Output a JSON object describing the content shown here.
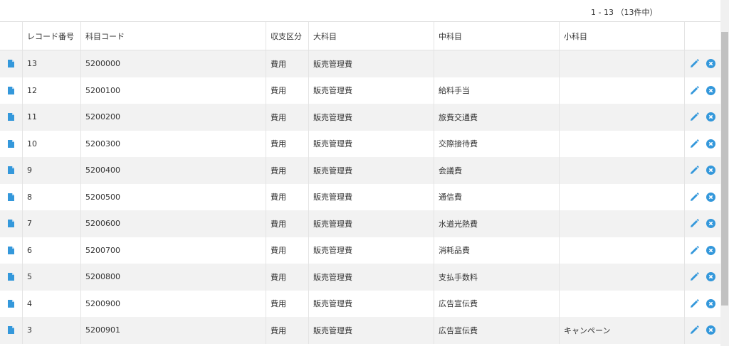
{
  "pager": {
    "text": "1 - 13 （13件中）"
  },
  "table": {
    "headers": [
      "",
      "レコード番号",
      "科目コード",
      "収支区分",
      "大科目",
      "中科目",
      "小科目",
      ""
    ],
    "rows": [
      {
        "record_no": "13",
        "code": "5200000",
        "kubun": "費用",
        "dai": "販売管理費",
        "chu": "",
        "sho": ""
      },
      {
        "record_no": "12",
        "code": "5200100",
        "kubun": "費用",
        "dai": "販売管理費",
        "chu": "給料手当",
        "sho": ""
      },
      {
        "record_no": "11",
        "code": "5200200",
        "kubun": "費用",
        "dai": "販売管理費",
        "chu": "旅費交通費",
        "sho": ""
      },
      {
        "record_no": "10",
        "code": "5200300",
        "kubun": "費用",
        "dai": "販売管理費",
        "chu": "交際接待費",
        "sho": ""
      },
      {
        "record_no": "9",
        "code": "5200400",
        "kubun": "費用",
        "dai": "販売管理費",
        "chu": "会議費",
        "sho": ""
      },
      {
        "record_no": "8",
        "code": "5200500",
        "kubun": "費用",
        "dai": "販売管理費",
        "chu": "通信費",
        "sho": ""
      },
      {
        "record_no": "7",
        "code": "5200600",
        "kubun": "費用",
        "dai": "販売管理費",
        "chu": "水道光熱費",
        "sho": ""
      },
      {
        "record_no": "6",
        "code": "5200700",
        "kubun": "費用",
        "dai": "販売管理費",
        "chu": "消耗品費",
        "sho": ""
      },
      {
        "record_no": "5",
        "code": "5200800",
        "kubun": "費用",
        "dai": "販売管理費",
        "chu": "支払手数料",
        "sho": ""
      },
      {
        "record_no": "4",
        "code": "5200900",
        "kubun": "費用",
        "dai": "販売管理費",
        "chu": "広告宣伝費",
        "sho": ""
      },
      {
        "record_no": "3",
        "code": "5200901",
        "kubun": "費用",
        "dai": "販売管理費",
        "chu": "広告宣伝費",
        "sho": "キャンペーン"
      }
    ]
  },
  "icons": {
    "row_icon": "document-icon",
    "edit_icon": "pencil-icon",
    "delete_icon": "close-circle-icon",
    "accent_color": "#3498db"
  }
}
